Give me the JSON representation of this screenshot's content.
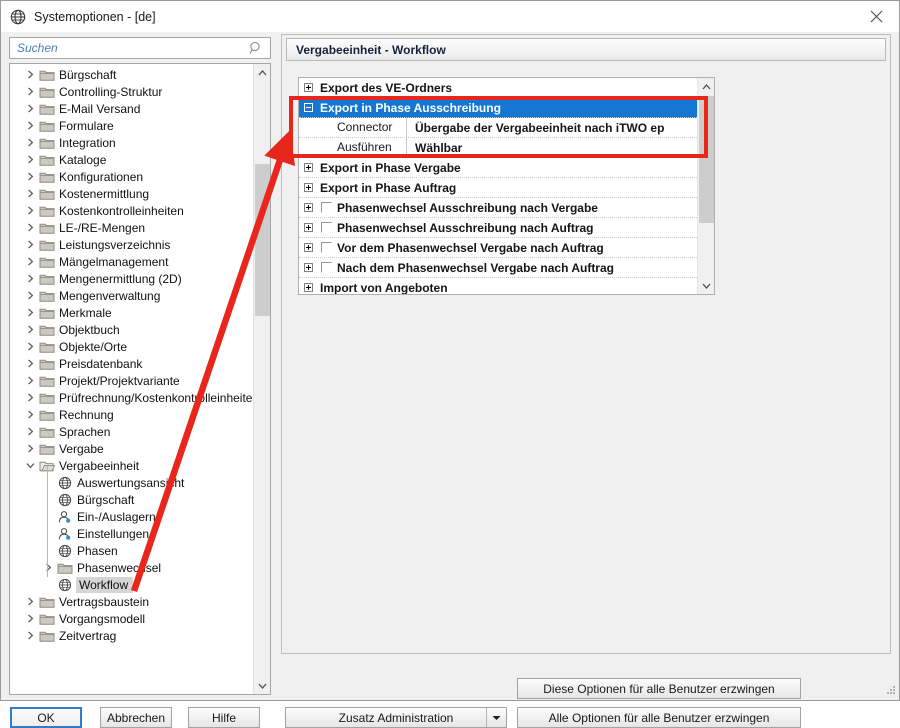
{
  "window": {
    "title": "Systemoptionen - [de]",
    "title_icon": "globe-icon",
    "close_icon": "close-icon"
  },
  "colors": {
    "selection_blue": "#1577d4",
    "annotation_red": "#e8261b",
    "focus_blue": "#2f7bd0",
    "placeholder_blue": "#4a7ebb",
    "tree_selection_grey": "#d5d5d5"
  },
  "search": {
    "placeholder": "Suchen",
    "value": "",
    "icon": "search-icon"
  },
  "tree": {
    "items": [
      {
        "label": "Bürgschaft",
        "icon": "folder-icon",
        "expander": "collapsed",
        "level": 0
      },
      {
        "label": "Controlling-Struktur",
        "icon": "folder-icon",
        "expander": "collapsed",
        "level": 0
      },
      {
        "label": "E-Mail Versand",
        "icon": "folder-icon",
        "expander": "collapsed",
        "level": 0
      },
      {
        "label": "Formulare",
        "icon": "folder-icon",
        "expander": "collapsed",
        "level": 0
      },
      {
        "label": "Integration",
        "icon": "folder-icon",
        "expander": "collapsed",
        "level": 0
      },
      {
        "label": "Kataloge",
        "icon": "folder-icon",
        "expander": "collapsed",
        "level": 0
      },
      {
        "label": "Konfigurationen",
        "icon": "folder-icon",
        "expander": "collapsed",
        "level": 0
      },
      {
        "label": "Kostenermittlung",
        "icon": "folder-icon",
        "expander": "collapsed",
        "level": 0
      },
      {
        "label": "Kostenkontrolleinheiten",
        "icon": "folder-icon",
        "expander": "collapsed",
        "level": 0
      },
      {
        "label": "LE-/RE-Mengen",
        "icon": "folder-icon",
        "expander": "collapsed",
        "level": 0
      },
      {
        "label": "Leistungsverzeichnis",
        "icon": "folder-icon",
        "expander": "collapsed",
        "level": 0
      },
      {
        "label": "Mängelmanagement",
        "icon": "folder-icon",
        "expander": "collapsed",
        "level": 0
      },
      {
        "label": "Mengenermittlung (2D)",
        "icon": "folder-icon",
        "expander": "collapsed",
        "level": 0
      },
      {
        "label": "Mengenverwaltung",
        "icon": "folder-icon",
        "expander": "collapsed",
        "level": 0
      },
      {
        "label": "Merkmale",
        "icon": "folder-icon",
        "expander": "collapsed",
        "level": 0
      },
      {
        "label": "Objektbuch",
        "icon": "folder-icon",
        "expander": "collapsed",
        "level": 0
      },
      {
        "label": "Objekte/Orte",
        "icon": "folder-icon",
        "expander": "collapsed",
        "level": 0
      },
      {
        "label": "Preisdatenbank",
        "icon": "folder-icon",
        "expander": "collapsed",
        "level": 0
      },
      {
        "label": "Projekt/Projektvariante",
        "icon": "folder-icon",
        "expander": "collapsed",
        "level": 0
      },
      {
        "label": "Prüfrechnung/Kostenkontrolleinheiten",
        "icon": "folder-icon",
        "expander": "collapsed",
        "level": 0
      },
      {
        "label": "Rechnung",
        "icon": "folder-icon",
        "expander": "collapsed",
        "level": 0
      },
      {
        "label": "Sprachen",
        "icon": "folder-icon",
        "expander": "collapsed",
        "level": 0
      },
      {
        "label": "Vergabe",
        "icon": "folder-icon",
        "expander": "collapsed",
        "level": 0
      },
      {
        "label": "Vergabeeinheit",
        "icon": "folder-open-icon",
        "expander": "expanded",
        "level": 0
      },
      {
        "label": "Auswertungsansicht",
        "icon": "globe-icon",
        "expander": "none",
        "level": 1
      },
      {
        "label": "Bürgschaft",
        "icon": "globe-icon",
        "expander": "none",
        "level": 1
      },
      {
        "label": "Ein-/Auslagern",
        "icon": "user-icon",
        "expander": "none",
        "level": 1
      },
      {
        "label": "Einstellungen",
        "icon": "user-icon",
        "expander": "none",
        "level": 1
      },
      {
        "label": "Phasen",
        "icon": "globe-icon",
        "expander": "none",
        "level": 1
      },
      {
        "label": "Phasenwechsel",
        "icon": "folder-icon",
        "expander": "collapsed",
        "level": 1
      },
      {
        "label": "Workflow",
        "icon": "globe-icon",
        "expander": "none",
        "level": 1,
        "selected": true
      },
      {
        "label": "Vertragsbaustein",
        "icon": "folder-icon",
        "expander": "collapsed",
        "level": 0
      },
      {
        "label": "Vorgangsmodell",
        "icon": "folder-icon",
        "expander": "collapsed",
        "level": 0
      },
      {
        "label": "Zeitvertrag",
        "icon": "folder-icon",
        "expander": "collapsed",
        "level": 0
      }
    ]
  },
  "panel": {
    "header": "Vergabeeinheit - Workflow",
    "rows": [
      {
        "kind": "group",
        "label": "Export des VE-Ordners",
        "expander": "collapsed",
        "checkbox": false
      },
      {
        "kind": "group",
        "label": "Export in Phase Ausschreibung",
        "expander": "expanded",
        "checkbox": false,
        "selected": true
      },
      {
        "kind": "property",
        "name": "Connector",
        "value": "Übergabe der Vergabeeinheit nach iTWO ep"
      },
      {
        "kind": "property",
        "name": "Ausführen",
        "value": "Wählbar"
      },
      {
        "kind": "group",
        "label": "Export in Phase Vergabe",
        "expander": "collapsed",
        "checkbox": false
      },
      {
        "kind": "group",
        "label": "Export in Phase Auftrag",
        "expander": "collapsed",
        "checkbox": false
      },
      {
        "kind": "group",
        "label": "Phasenwechsel Ausschreibung nach Vergabe",
        "expander": "collapsed",
        "checkbox": true,
        "checked": false
      },
      {
        "kind": "group",
        "label": "Phasenwechsel Ausschreibung nach Auftrag",
        "expander": "collapsed",
        "checkbox": true,
        "checked": false
      },
      {
        "kind": "group",
        "label": "Vor dem Phasenwechsel Vergabe nach Auftrag",
        "expander": "collapsed",
        "checkbox": true,
        "checked": false
      },
      {
        "kind": "group",
        "label": "Nach dem Phasenwechsel Vergabe nach Auftrag",
        "expander": "collapsed",
        "checkbox": true,
        "checked": false
      },
      {
        "kind": "group",
        "label": "Import von Angeboten",
        "expander": "collapsed",
        "checkbox": false
      }
    ]
  },
  "buttons": {
    "ok": "OK",
    "cancel": "Abbrechen",
    "help": "Hilfe",
    "zusatz_administration": "Zusatz Administration",
    "force_these": "Diese Optionen für alle Benutzer erzwingen",
    "force_all": "Alle Optionen für alle Benutzer erzwingen"
  }
}
